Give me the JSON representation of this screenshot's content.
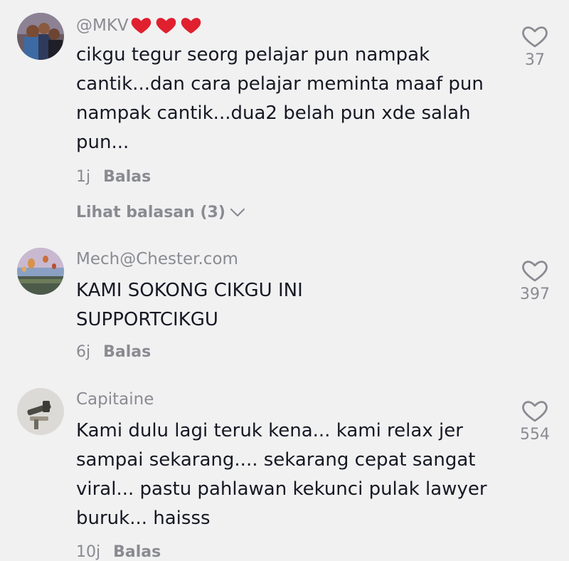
{
  "comments": [
    {
      "username": "@MKV",
      "username_hearts": 3,
      "text": "cikgu tegur seorg pelajar pun nampak cantik...dan cara pelajar meminta maaf pun nampak cantik...dua2 belah pun xde salah pun...",
      "time": "1j",
      "reply_label": "Balas",
      "view_replies": "Lihat balasan (3)",
      "likes": "37"
    },
    {
      "username": "Mech@Chester.com",
      "text_lines": [
        "KAMI SOKONG CIKGU INI",
        "SUPPORTCIKGU"
      ],
      "time": "6j",
      "reply_label": "Balas",
      "likes": "397"
    },
    {
      "username": "Capitaine",
      "text": "Kami dulu lagi teruk kena... kami relax jer sampai sekarang.... sekarang cepat sangat viral... pastu pahlawan kekunci pulak lawyer buruk... haisss",
      "time": "10j",
      "reply_label": "Balas",
      "likes": "554"
    }
  ],
  "colors": {
    "background": "#f1f1f2",
    "text": "#161823",
    "muted": "#8a8b91",
    "heart_emoji": "#e0202f"
  },
  "icons": {
    "like": "heart-outline-icon",
    "username_emoji": "red-heart-icon",
    "expand": "chevron-down-icon"
  }
}
